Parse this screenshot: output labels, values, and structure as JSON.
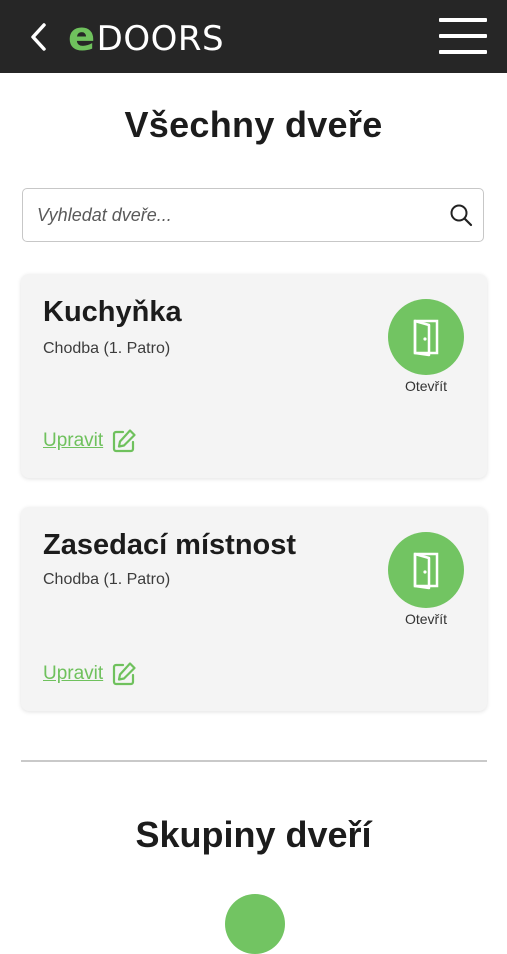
{
  "header": {
    "logo_e": "e",
    "logo_text": "DOORS",
    "back_icon": "chevron-left-icon",
    "menu_icon": "hamburger-menu-icon"
  },
  "page_title": "Všechny dveře",
  "search": {
    "placeholder": "Vyhledat dveře...",
    "value": "",
    "icon": "search-icon"
  },
  "doors": [
    {
      "name": "Kuchyňka",
      "location": "Chodba (1. Patro)",
      "open_label": "Otevřít",
      "edit_label": "Upravit"
    },
    {
      "name": "Zasedací místnost",
      "location": "Chodba (1. Patro)",
      "open_label": "Otevřít",
      "edit_label": "Upravit"
    }
  ],
  "groups_title": "Skupiny dveří",
  "colors": {
    "accent": "#72c462",
    "topbar": "#262626",
    "card": "#f4f4f4"
  }
}
